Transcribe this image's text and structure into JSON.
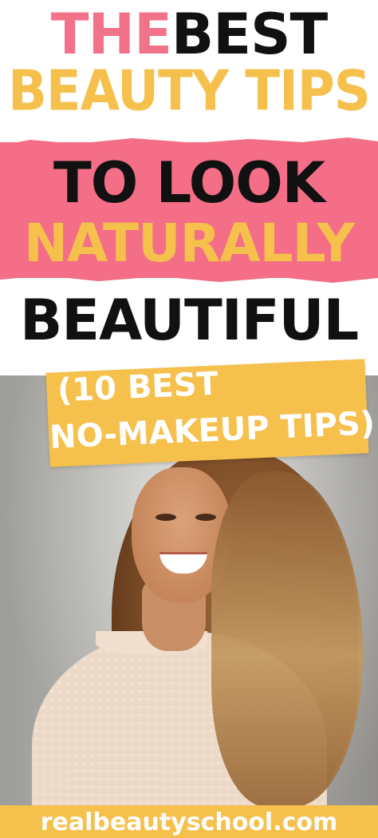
{
  "headline": {
    "the": "THE",
    "best": "BEST",
    "line2": "BEAUTY TIPS",
    "line3": "TO LOOK",
    "line4": "NATURALLY",
    "line5": "BEAUTIFUL"
  },
  "subtitle": {
    "line1": "(10 BEST",
    "line2": "NO-MAKEUP TIPS)"
  },
  "footer": {
    "website": "realbeautyschool.com"
  },
  "colors": {
    "pink": "#f36e86",
    "yellow": "#f5c04c",
    "black": "#111111"
  }
}
